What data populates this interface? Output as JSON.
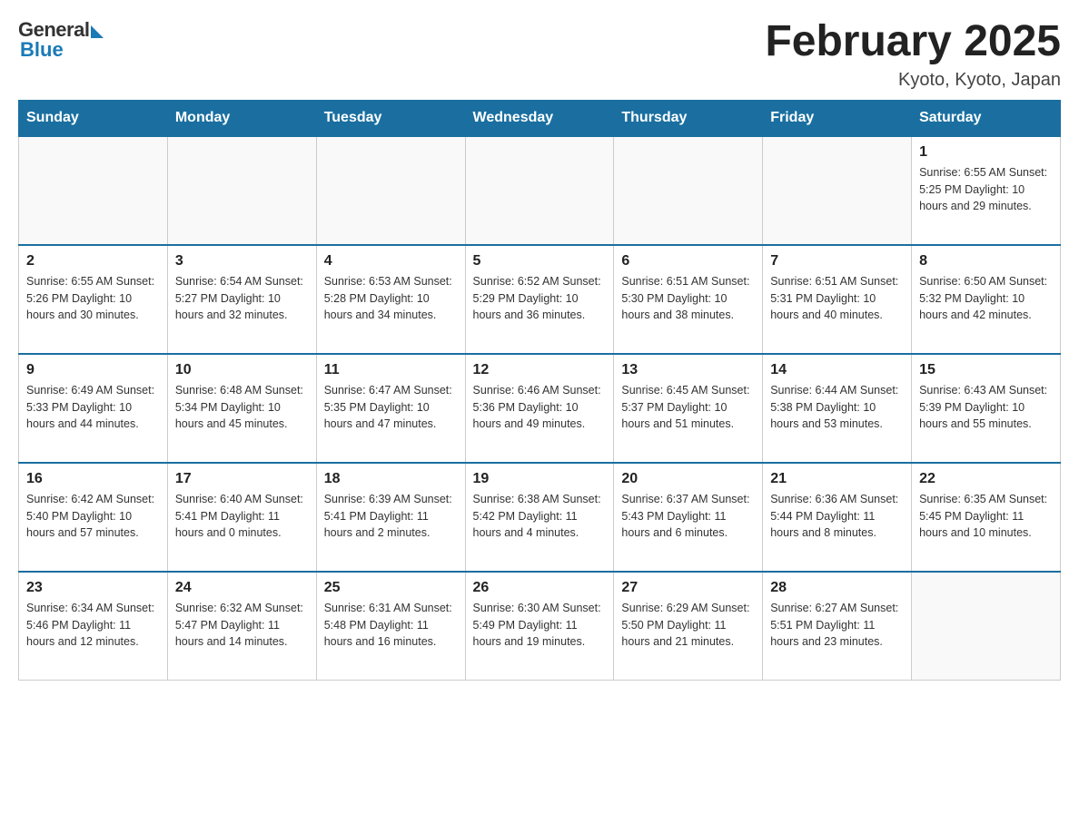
{
  "header": {
    "logo": {
      "general": "General",
      "blue": "Blue"
    },
    "title": "February 2025",
    "subtitle": "Kyoto, Kyoto, Japan"
  },
  "days_of_week": [
    "Sunday",
    "Monday",
    "Tuesday",
    "Wednesday",
    "Thursday",
    "Friday",
    "Saturday"
  ],
  "weeks": [
    [
      {
        "day": "",
        "info": ""
      },
      {
        "day": "",
        "info": ""
      },
      {
        "day": "",
        "info": ""
      },
      {
        "day": "",
        "info": ""
      },
      {
        "day": "",
        "info": ""
      },
      {
        "day": "",
        "info": ""
      },
      {
        "day": "1",
        "info": "Sunrise: 6:55 AM\nSunset: 5:25 PM\nDaylight: 10 hours and 29 minutes."
      }
    ],
    [
      {
        "day": "2",
        "info": "Sunrise: 6:55 AM\nSunset: 5:26 PM\nDaylight: 10 hours and 30 minutes."
      },
      {
        "day": "3",
        "info": "Sunrise: 6:54 AM\nSunset: 5:27 PM\nDaylight: 10 hours and 32 minutes."
      },
      {
        "day": "4",
        "info": "Sunrise: 6:53 AM\nSunset: 5:28 PM\nDaylight: 10 hours and 34 minutes."
      },
      {
        "day": "5",
        "info": "Sunrise: 6:52 AM\nSunset: 5:29 PM\nDaylight: 10 hours and 36 minutes."
      },
      {
        "day": "6",
        "info": "Sunrise: 6:51 AM\nSunset: 5:30 PM\nDaylight: 10 hours and 38 minutes."
      },
      {
        "day": "7",
        "info": "Sunrise: 6:51 AM\nSunset: 5:31 PM\nDaylight: 10 hours and 40 minutes."
      },
      {
        "day": "8",
        "info": "Sunrise: 6:50 AM\nSunset: 5:32 PM\nDaylight: 10 hours and 42 minutes."
      }
    ],
    [
      {
        "day": "9",
        "info": "Sunrise: 6:49 AM\nSunset: 5:33 PM\nDaylight: 10 hours and 44 minutes."
      },
      {
        "day": "10",
        "info": "Sunrise: 6:48 AM\nSunset: 5:34 PM\nDaylight: 10 hours and 45 minutes."
      },
      {
        "day": "11",
        "info": "Sunrise: 6:47 AM\nSunset: 5:35 PM\nDaylight: 10 hours and 47 minutes."
      },
      {
        "day": "12",
        "info": "Sunrise: 6:46 AM\nSunset: 5:36 PM\nDaylight: 10 hours and 49 minutes."
      },
      {
        "day": "13",
        "info": "Sunrise: 6:45 AM\nSunset: 5:37 PM\nDaylight: 10 hours and 51 minutes."
      },
      {
        "day": "14",
        "info": "Sunrise: 6:44 AM\nSunset: 5:38 PM\nDaylight: 10 hours and 53 minutes."
      },
      {
        "day": "15",
        "info": "Sunrise: 6:43 AM\nSunset: 5:39 PM\nDaylight: 10 hours and 55 minutes."
      }
    ],
    [
      {
        "day": "16",
        "info": "Sunrise: 6:42 AM\nSunset: 5:40 PM\nDaylight: 10 hours and 57 minutes."
      },
      {
        "day": "17",
        "info": "Sunrise: 6:40 AM\nSunset: 5:41 PM\nDaylight: 11 hours and 0 minutes."
      },
      {
        "day": "18",
        "info": "Sunrise: 6:39 AM\nSunset: 5:41 PM\nDaylight: 11 hours and 2 minutes."
      },
      {
        "day": "19",
        "info": "Sunrise: 6:38 AM\nSunset: 5:42 PM\nDaylight: 11 hours and 4 minutes."
      },
      {
        "day": "20",
        "info": "Sunrise: 6:37 AM\nSunset: 5:43 PM\nDaylight: 11 hours and 6 minutes."
      },
      {
        "day": "21",
        "info": "Sunrise: 6:36 AM\nSunset: 5:44 PM\nDaylight: 11 hours and 8 minutes."
      },
      {
        "day": "22",
        "info": "Sunrise: 6:35 AM\nSunset: 5:45 PM\nDaylight: 11 hours and 10 minutes."
      }
    ],
    [
      {
        "day": "23",
        "info": "Sunrise: 6:34 AM\nSunset: 5:46 PM\nDaylight: 11 hours and 12 minutes."
      },
      {
        "day": "24",
        "info": "Sunrise: 6:32 AM\nSunset: 5:47 PM\nDaylight: 11 hours and 14 minutes."
      },
      {
        "day": "25",
        "info": "Sunrise: 6:31 AM\nSunset: 5:48 PM\nDaylight: 11 hours and 16 minutes."
      },
      {
        "day": "26",
        "info": "Sunrise: 6:30 AM\nSunset: 5:49 PM\nDaylight: 11 hours and 19 minutes."
      },
      {
        "day": "27",
        "info": "Sunrise: 6:29 AM\nSunset: 5:50 PM\nDaylight: 11 hours and 21 minutes."
      },
      {
        "day": "28",
        "info": "Sunrise: 6:27 AM\nSunset: 5:51 PM\nDaylight: 11 hours and 23 minutes."
      },
      {
        "day": "",
        "info": ""
      }
    ]
  ]
}
